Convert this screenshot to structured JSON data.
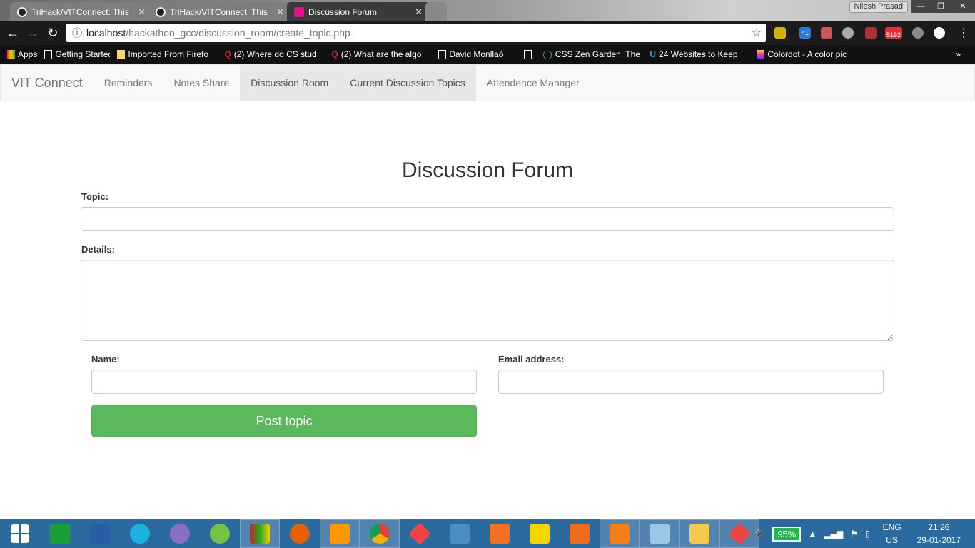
{
  "browser": {
    "tabs": [
      {
        "title": "TriHack/VITConnect: This"
      },
      {
        "title": "TriHack/VITConnect: This"
      },
      {
        "title": "Discussion Forum",
        "active": true
      }
    ],
    "profile_name": "Nilesh Prasad",
    "url_host": "localhost",
    "url_path": "/hackathon_gcc/discussion_room/create_topic.php",
    "extension_badges": {
      "badge_41": "41",
      "mail_count": "5192"
    },
    "bookmarks": [
      "Apps",
      "Getting Started",
      "Imported From Firefo",
      "(2) Where do CS stud",
      "(2) What are the algo",
      "David Monllaó",
      "CSS Zen Garden: The",
      "24 Websites to Keep",
      "Colordot - A color pic"
    ]
  },
  "navbar": {
    "brand": "VIT Connect",
    "items": [
      {
        "label": "Reminders",
        "active": false
      },
      {
        "label": "Notes Share",
        "active": false
      },
      {
        "label": "Discussion Room",
        "active": true
      },
      {
        "label": "Current Discussion Topics",
        "active": true
      },
      {
        "label": "Attendence Manager",
        "active": false
      }
    ]
  },
  "form": {
    "title": "Discussion Forum",
    "topic_label": "Topic:",
    "topic_value": "",
    "details_label": "Details:",
    "details_value": "",
    "name_label": "Name:",
    "name_value": "",
    "email_label": "Email address:",
    "email_value": "",
    "submit_label": "Post topic",
    "submit_color": "#5cb85c"
  },
  "taskbar": {
    "apps": [
      "start",
      "store",
      "powershell",
      "app-circle",
      "github-desktop",
      "android-studio",
      "winrar",
      "firefox",
      "sublime-text",
      "chrome",
      "git",
      "virtualbox",
      "media-player",
      "notes",
      "screenshot",
      "foxit-pdf",
      "notepad",
      "file-explorer",
      "git-gui"
    ],
    "battery": "95%",
    "lang": "ENG",
    "region": "US",
    "time": "21:26",
    "date": "29-01-2017"
  }
}
